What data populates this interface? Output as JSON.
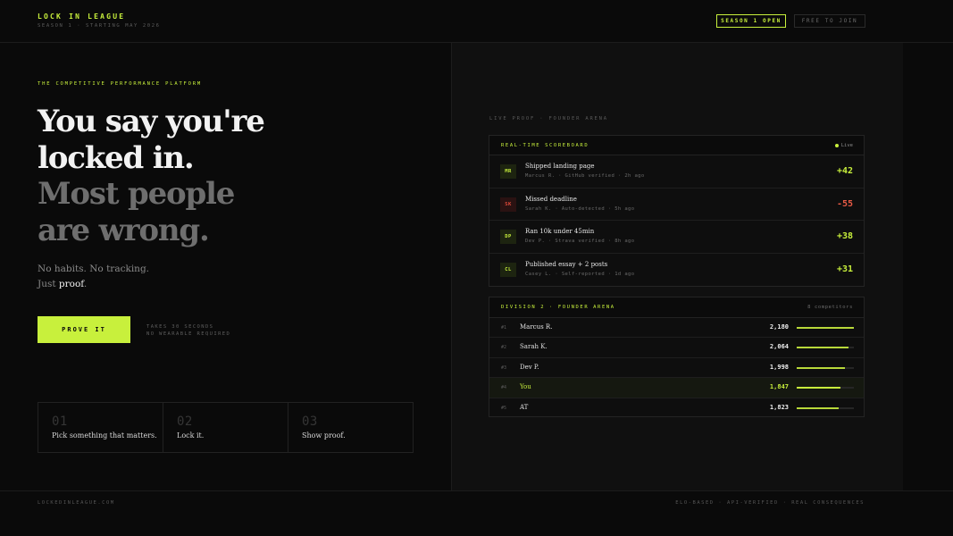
{
  "header": {
    "brand_title": "LOCK IN LEAGUE",
    "brand_sub": "SEASON 1 · STARTING MAY 2026",
    "season_badge": "SEASON 1 OPEN",
    "free_badge": "FREE TO JOIN"
  },
  "hero": {
    "eyebrow": "THE COMPETITIVE PERFORMANCE PLATFORM",
    "headline_line1": "You say you're",
    "headline_line2": "locked in.",
    "headline_line3": "Most people",
    "headline_line4": "are wrong.",
    "sub_line1": "No habits. No tracking.",
    "sub_line2_prefix": "Just ",
    "sub_line2_emph": "proof",
    "sub_line2_suffix": ".",
    "cta_label": "PROVE IT",
    "cta_note_line1": "TAKES 30 SECONDS",
    "cta_note_line2": "NO WEARABLE REQUIRED"
  },
  "steps": [
    {
      "num": "01",
      "label": "Pick something that matters."
    },
    {
      "num": "02",
      "label": "Lock it."
    },
    {
      "num": "03",
      "label": "Show proof."
    }
  ],
  "live": {
    "caption": "LIVE PROOF · FOUNDER ARENA"
  },
  "scoreboard": {
    "title": "REAL-TIME SCOREBOARD",
    "live_label": "Live",
    "rows": [
      {
        "initials": "MR",
        "title": "Shipped landing page",
        "meta": "Marcus R. · GitHub verified · 2h ago",
        "score": "+42"
      },
      {
        "initials": "SK",
        "title": "Missed deadline",
        "meta": "Sarah K. · Auto-detected · 5h ago",
        "score": "-55"
      },
      {
        "initials": "DP",
        "title": "Ran 10k under 45min",
        "meta": "Dev P. · Strava verified · 8h ago",
        "score": "+38"
      },
      {
        "initials": "CL",
        "title": "Published essay + 2 posts",
        "meta": "Casey L. · Self-reported · 1d ago",
        "score": "+31"
      }
    ]
  },
  "division": {
    "title": "DIVISION 2 · FOUNDER ARENA",
    "count": "8 competitors",
    "rows": [
      {
        "rank": "#1",
        "name": "Marcus R.",
        "points": "2,180",
        "progress": 1.0
      },
      {
        "rank": "#2",
        "name": "Sarah K.",
        "points": "2,064",
        "progress": 0.9
      },
      {
        "rank": "#3",
        "name": "Dev P.",
        "points": "1,998",
        "progress": 0.85
      },
      {
        "rank": "#4",
        "name": "You",
        "points": "1,847",
        "progress": 0.76
      },
      {
        "rank": "#5",
        "name": "AT",
        "points": "1,823",
        "progress": 0.74
      }
    ]
  },
  "footer": {
    "left": "LOCKEDINLEAGUE.COM",
    "right": "ELO-BASED · API-VERIFIED · REAL CONSEQUENCES"
  },
  "colors": {
    "accent": "#c8f03c",
    "negative": "#e85a45",
    "background": "#0a0a0a"
  }
}
